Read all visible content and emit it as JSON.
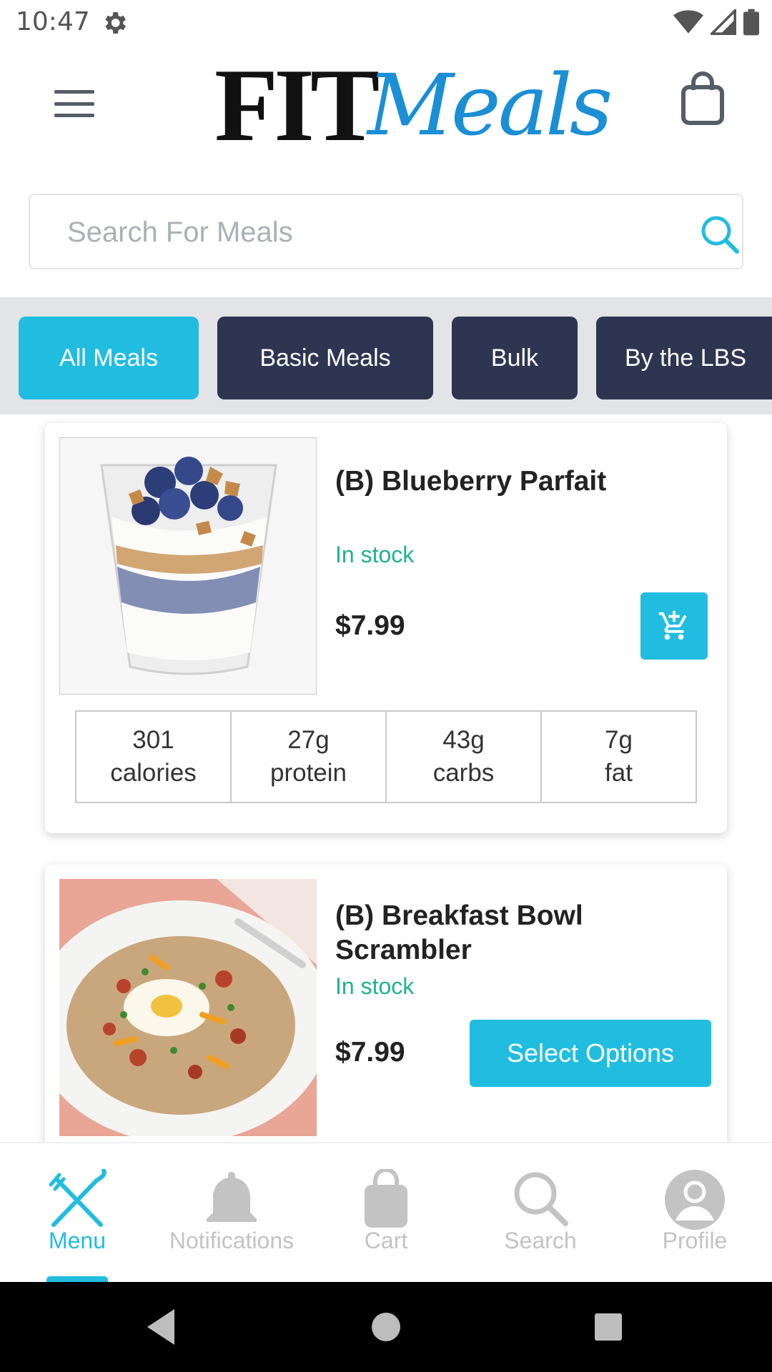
{
  "status_bar": {
    "time": "10:47",
    "icons": [
      "gear-icon",
      "wifi-icon",
      "cell-signal-icon",
      "battery-icon"
    ]
  },
  "header": {
    "logo_text_bold": "FIT",
    "logo_text_script": "Meals",
    "menu_icon": "hamburger-menu-icon",
    "cart_icon": "shopping-bag-icon"
  },
  "search": {
    "placeholder": "Search For Meals",
    "value": ""
  },
  "categories": [
    {
      "label": "All Meals",
      "active": true
    },
    {
      "label": "Basic Meals",
      "active": false
    },
    {
      "label": "Bulk",
      "active": false
    },
    {
      "label": "By the LBS",
      "active": false
    }
  ],
  "products": [
    {
      "title": "(B) Blueberry Parfait",
      "stock": "In stock",
      "price": "$7.99",
      "action": "add-to-cart",
      "nutrition": [
        {
          "value": "301",
          "unit": "calories"
        },
        {
          "value": "27g",
          "unit": "protein"
        },
        {
          "value": "43g",
          "unit": "carbs"
        },
        {
          "value": "7g",
          "unit": "fat"
        }
      ]
    },
    {
      "title_line1": "(B) Breakfast Bowl",
      "title_line2": "Scrambler",
      "stock": "In stock",
      "price": "$7.99",
      "action_label": "Select Options"
    }
  ],
  "bottom_nav": [
    {
      "label": "Menu",
      "icon": "fork-knife-icon",
      "active": true
    },
    {
      "label": "Notifications",
      "icon": "bell-icon",
      "active": false
    },
    {
      "label": "Cart",
      "icon": "shopping-bag-icon",
      "active": false
    },
    {
      "label": "Search",
      "icon": "search-icon",
      "active": false
    },
    {
      "label": "Profile",
      "icon": "profile-icon",
      "active": false
    }
  ],
  "colors": {
    "accent": "#21bde0",
    "pill_dark": "#2d3551",
    "stock_green": "#1fb38a",
    "nav_inactive": "#c3c3c3"
  }
}
